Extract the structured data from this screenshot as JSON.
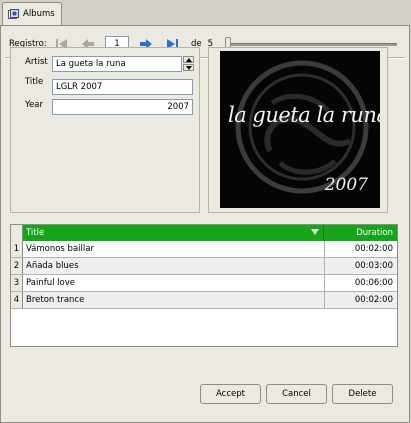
{
  "tab": {
    "label": "Albums",
    "icon": "albums-icon"
  },
  "nav": {
    "label": "Registro:",
    "record": "1",
    "of_label": "de",
    "total": "5",
    "icons": [
      "first-record-icon",
      "prev-record-icon",
      "next-record-icon",
      "last-record-icon"
    ],
    "slider_position": 0
  },
  "form": {
    "artist_label": "Artist",
    "artist_value": "La gueta la runa",
    "title_label": "Title",
    "title_value": "LGLR 2007",
    "year_label": "Year",
    "year_value": "2007"
  },
  "cover": {
    "script_text": "la gueta la runa",
    "year_text": "2007"
  },
  "table": {
    "columns": [
      "Title",
      "Duration"
    ],
    "rows": [
      {
        "num": "1",
        "title": "Vámonos baillar",
        "duration": "00:02:00"
      },
      {
        "num": "2",
        "title": "Añada blues",
        "duration": "00:03:00"
      },
      {
        "num": "3",
        "title": "Painful love",
        "duration": "00:06:00"
      },
      {
        "num": "4",
        "title": "Breton trance",
        "duration": "00:02:00"
      }
    ]
  },
  "buttons": {
    "accept": "Accept",
    "cancel": "Cancel",
    "delete": "Delete"
  },
  "colors": {
    "header_green": "#16a51a",
    "nav_blue": "#2b6fd4",
    "panel_bg": "#ece9e1"
  }
}
